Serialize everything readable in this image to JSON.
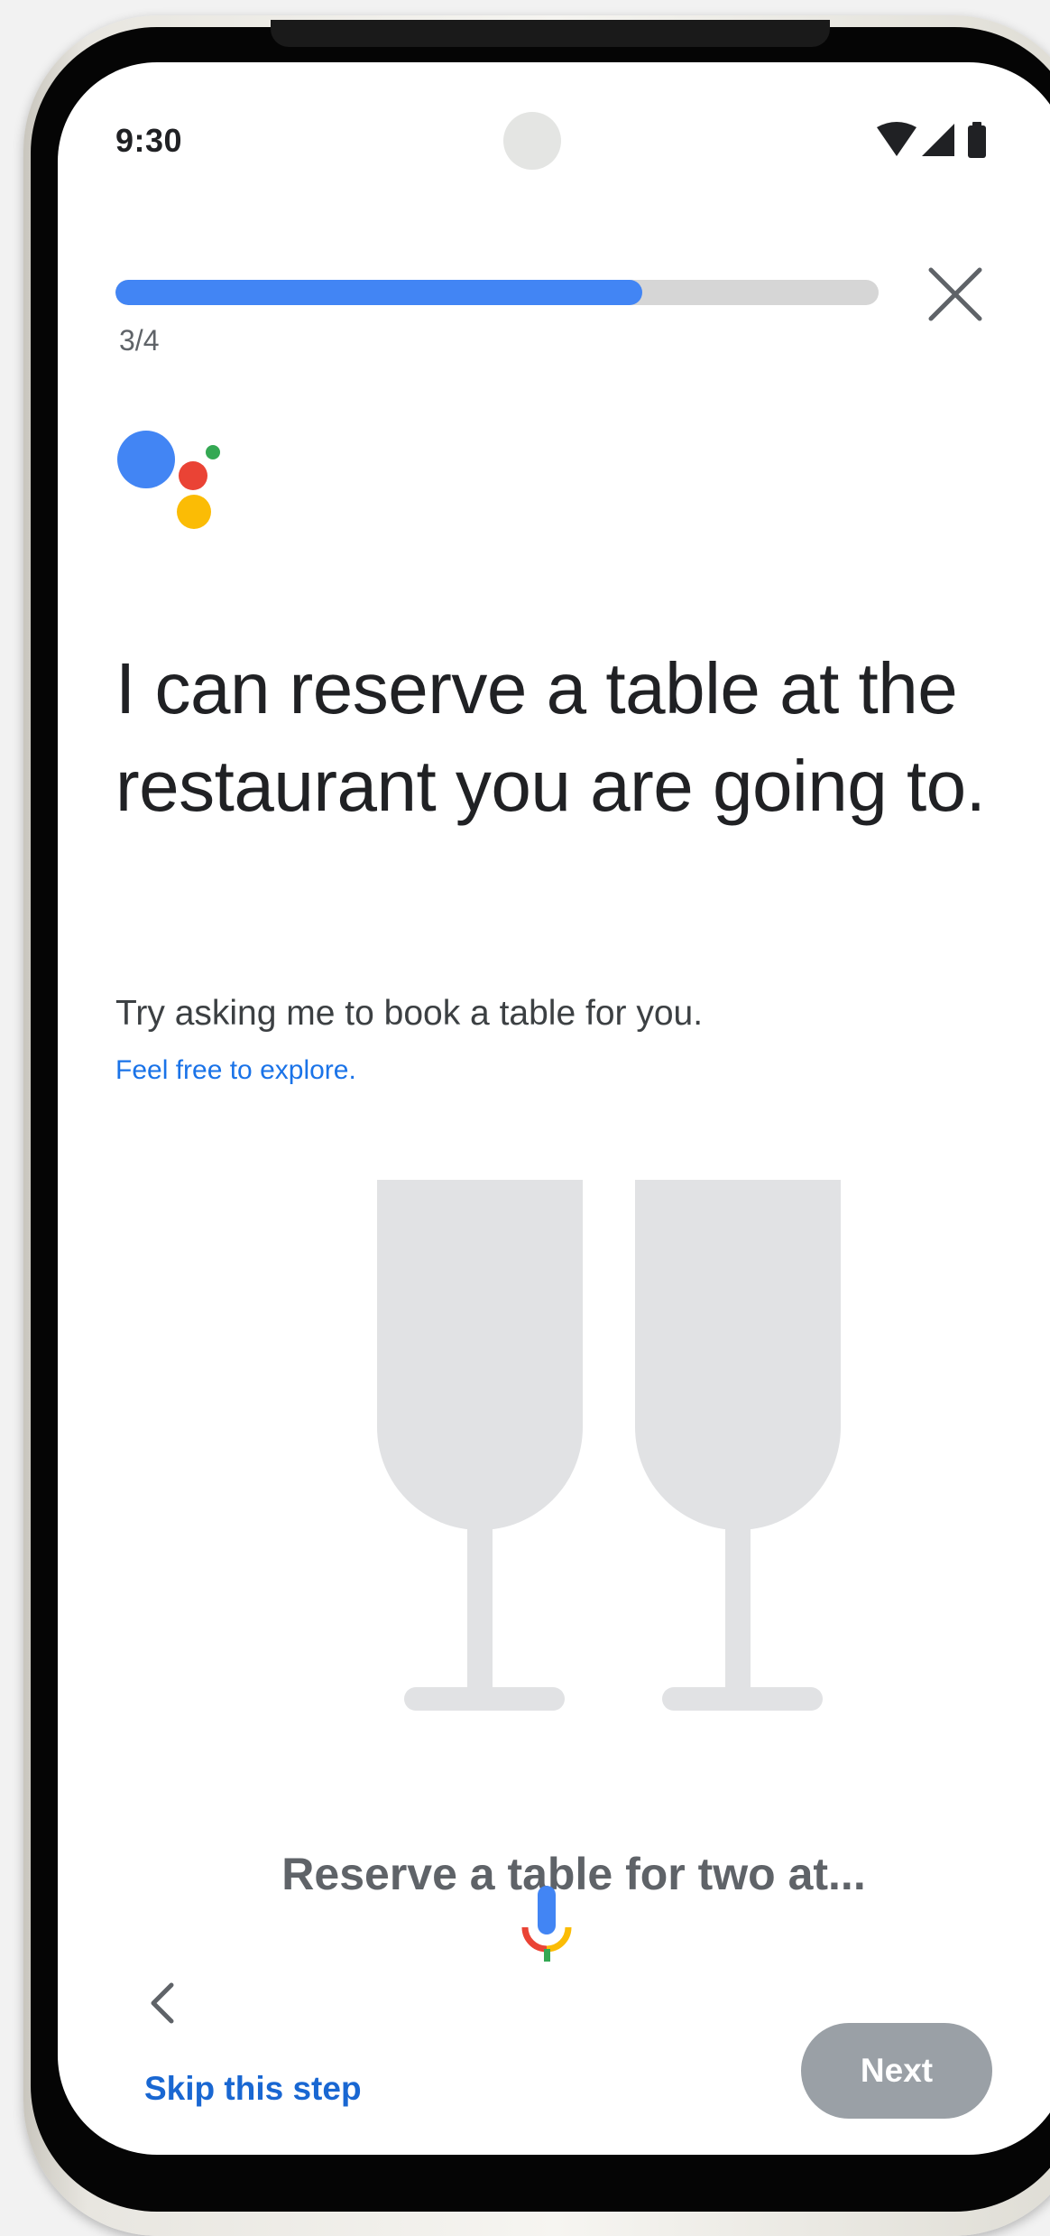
{
  "status_bar": {
    "time": "9:30",
    "icons": [
      "wifi-icon",
      "cellular-signal-icon",
      "battery-icon"
    ]
  },
  "progress": {
    "label": "3/4",
    "fraction": 0.69
  },
  "header": {
    "close_icon": "close-icon"
  },
  "assistant_logo": {
    "icon": "google-assistant-logo",
    "colors": [
      "#4285f4",
      "#ea4335",
      "#fbbc05",
      "#34a853"
    ]
  },
  "content": {
    "headline": "I can reserve a table at the restaurant you are going to.",
    "subtitle": "Try asking me to book a table for you.",
    "explore_link": "Feel free to explore.",
    "illustration": "wine-glasses-illustration"
  },
  "suggestion": {
    "text": "Reserve a table for two at..."
  },
  "footer": {
    "mic_icon": "microphone-icon",
    "back_icon": "chevron-left-icon",
    "skip_label": "Skip this step",
    "next_label": "Next"
  },
  "colors": {
    "accent": "#4285f4",
    "link": "#1a73e8",
    "progress_track": "#d6d6d6",
    "next_button": "#9aa0a6",
    "illustration": "#e1e2e4"
  }
}
